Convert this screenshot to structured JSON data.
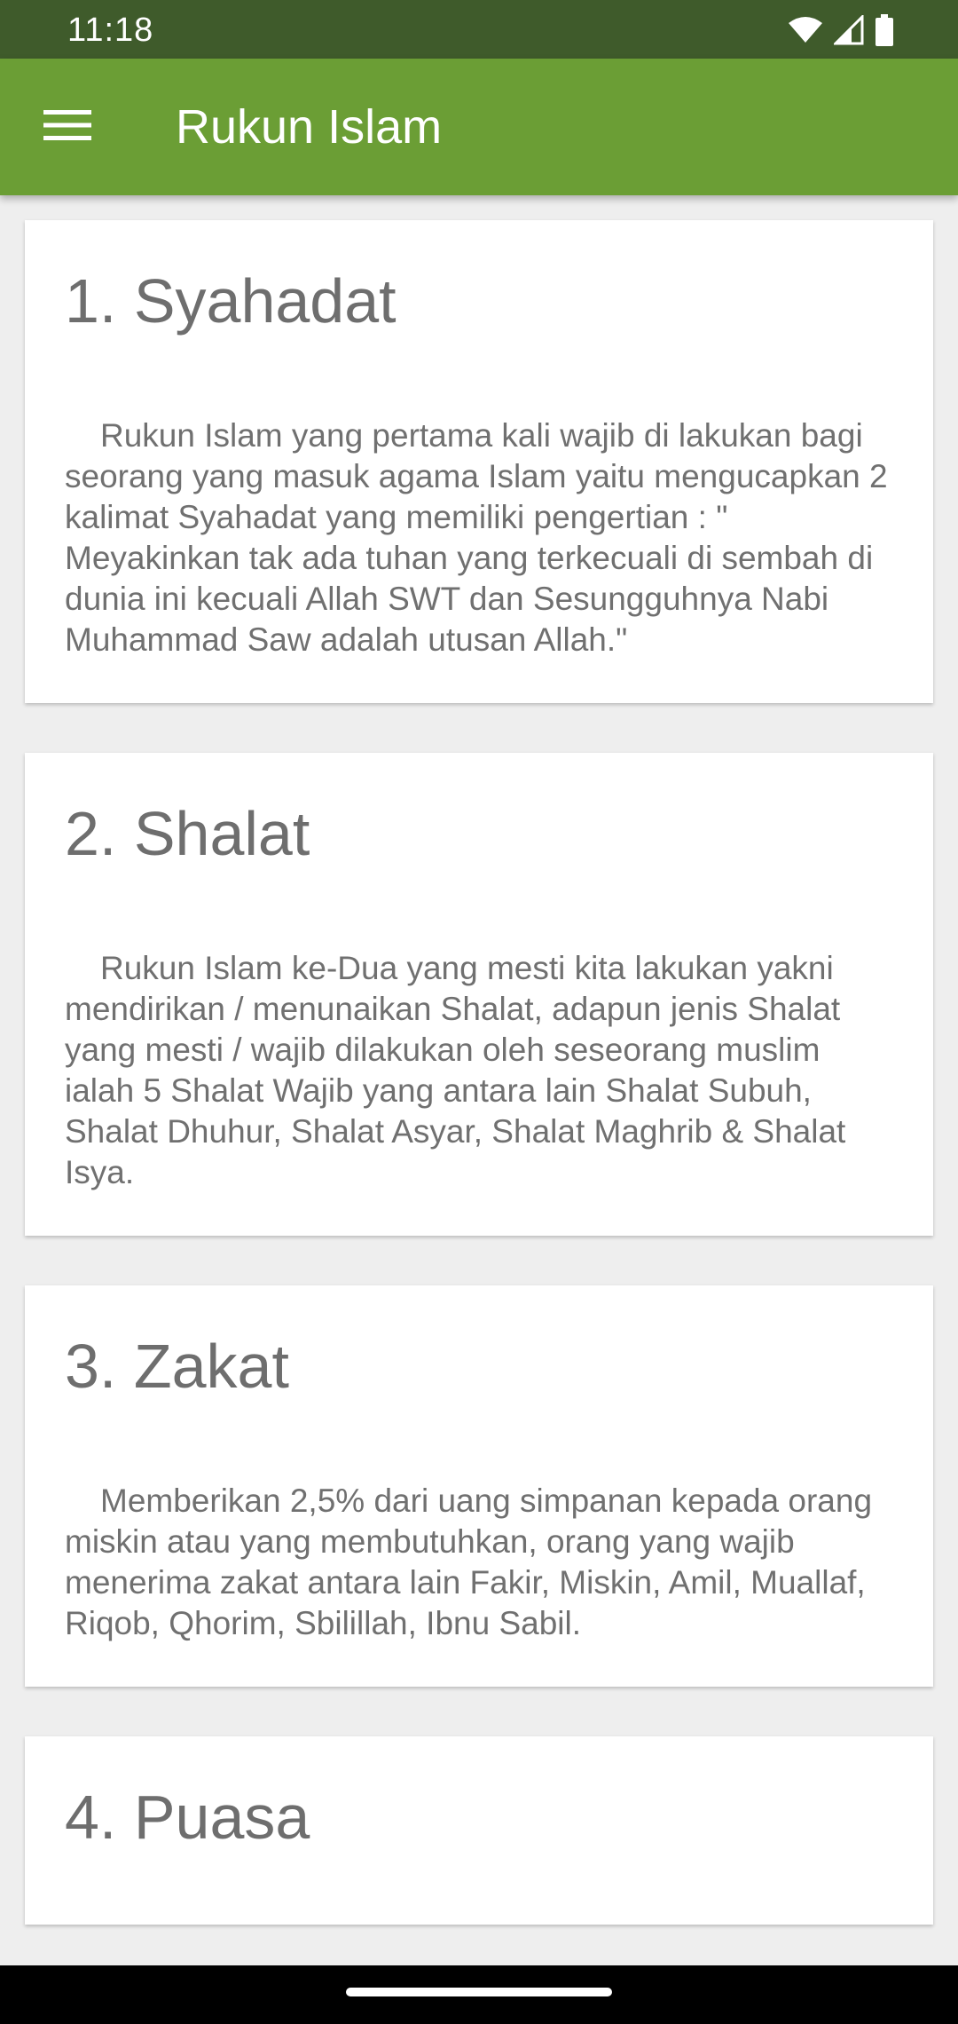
{
  "status_bar": {
    "time": "11:18",
    "icons": [
      "wifi-icon",
      "signal-icon",
      "battery-icon"
    ]
  },
  "app_bar": {
    "menu_icon": "hamburger-menu-icon",
    "title": "Rukun Islam",
    "color": "#6b9e35"
  },
  "cards": [
    {
      "title": "1. Syahadat",
      "body": "Rukun Islam yang pertama kali wajib di lakukan bagi seorang yang masuk agama Islam yaitu mengucapkan 2 kalimat Syahadat yang memiliki pengertian : \" Meyakinkan tak ada tuhan yang terkecuali di sembah di dunia ini kecuali Allah SWT dan Sesungguhnya Nabi Muhammad Saw adalah utusan Allah.\""
    },
    {
      "title": "2. Shalat",
      "body": "Rukun Islam ke-Dua yang mesti kita lakukan yakni mendirikan / menunaikan Shalat, adapun jenis Shalat yang mesti / wajib dilakukan oleh seseorang muslim ialah 5 Shalat Wajib yang antara lain Shalat Subuh, Shalat Dhuhur, Shalat Asyar, Shalat Maghrib & Shalat Isya."
    },
    {
      "title": "3. Zakat",
      "body": "Memberikan 2,5% dari uang simpanan kepada orang miskin atau yang membutuhkan, orang yang wajib menerima zakat antara lain Fakir, Miskin, Amil, Muallaf, Riqob, Qhorim, Sbilillah, Ibnu Sabil."
    },
    {
      "title": "4. Puasa"
    }
  ]
}
